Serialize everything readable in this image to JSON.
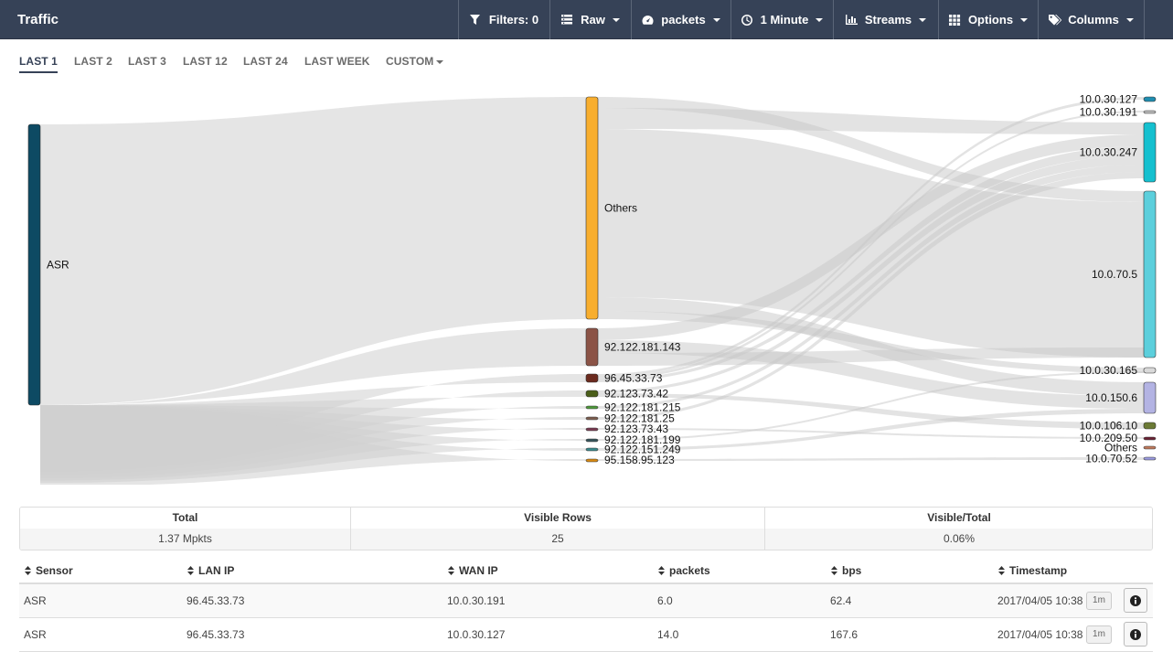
{
  "app": {
    "title": "Traffic"
  },
  "toolbar": [
    {
      "id": "filters",
      "label": "Filters: 0",
      "icon": "filter-icon",
      "caret": false
    },
    {
      "id": "raw",
      "label": "Raw",
      "icon": "list-icon",
      "caret": true
    },
    {
      "id": "packets",
      "label": "packets",
      "icon": "dashboard-icon",
      "caret": true
    },
    {
      "id": "interval",
      "label": "1 Minute",
      "icon": "clock-icon",
      "caret": true
    },
    {
      "id": "streams",
      "label": "Streams",
      "icon": "bar-chart-icon",
      "caret": true
    },
    {
      "id": "options",
      "label": "Options",
      "icon": "grid-icon",
      "caret": true
    },
    {
      "id": "columns",
      "label": "Columns",
      "icon": "tags-icon",
      "caret": true
    }
  ],
  "time_tabs": [
    {
      "label": "LAST 1",
      "active": true
    },
    {
      "label": "LAST 2",
      "active": false
    },
    {
      "label": "LAST 3",
      "active": false
    },
    {
      "label": "LAST 12",
      "active": false
    },
    {
      "label": "LAST 24",
      "active": false
    },
    {
      "label": "LAST WEEK",
      "active": false
    },
    {
      "label": "CUSTOM",
      "active": false,
      "caret": true
    }
  ],
  "sankey": {
    "sources": [
      {
        "label": "ASR",
        "color": "#0d4a63"
      }
    ],
    "middle": [
      {
        "label": "Others",
        "color": "#f8ae2e"
      },
      {
        "label": "92.122.181.143",
        "color": "#8b5346"
      },
      {
        "label": "96.45.33.73",
        "color": "#6b2a1e"
      },
      {
        "label": "92.123.73.42",
        "color": "#4a5e19"
      },
      {
        "label": "92.122.181.215",
        "color": "#4e9a3a"
      },
      {
        "label": "92.122.181.25",
        "color": "#7d5e4f"
      },
      {
        "label": "92.123.73.43",
        "color": "#7a3b52"
      },
      {
        "label": "92.122.181.199",
        "color": "#37545a"
      },
      {
        "label": "92.122.151.249",
        "color": "#3a8a8d"
      },
      {
        "label": "95.158.95.123",
        "color": "#d98a12"
      }
    ],
    "targets": [
      {
        "label": "10.0.30.127",
        "color": "#1f8db0"
      },
      {
        "label": "10.0.30.191",
        "color": "#bcbcbc"
      },
      {
        "label": "10.0.30.247",
        "color": "#15c0cf"
      },
      {
        "label": "10.0.70.5",
        "color": "#5ccfdc"
      },
      {
        "label": "10.0.30.165",
        "color": "#d9d9d9"
      },
      {
        "label": "10.0.150.6",
        "color": "#b3b3e3"
      },
      {
        "label": "10.0.106.10",
        "color": "#6b7a35"
      },
      {
        "label": "10.0.209.50",
        "color": "#6b2234"
      },
      {
        "label": "Others",
        "color": "#c17a5c"
      },
      {
        "label": "10.0.70.52",
        "color": "#9b9be0"
      }
    ]
  },
  "summary": [
    {
      "header": "Total",
      "value": "1.37 Mpkts"
    },
    {
      "header": "Visible Rows",
      "value": "25"
    },
    {
      "header": "Visible/Total",
      "value": "0.06%"
    }
  ],
  "table": {
    "columns": [
      "Sensor",
      "LAN IP",
      "WAN IP",
      "packets",
      "bps",
      "Timestamp"
    ],
    "rows": [
      {
        "sensor": "ASR",
        "lan_ip": "96.45.33.73",
        "wan_ip": "10.0.30.191",
        "packets": "6.0",
        "bps": "62.4",
        "timestamp": "2017/04/05 10:38",
        "interval": "1m"
      },
      {
        "sensor": "ASR",
        "lan_ip": "96.45.33.73",
        "wan_ip": "10.0.30.127",
        "packets": "14.0",
        "bps": "167.6",
        "timestamp": "2017/04/05 10:38",
        "interval": "1m"
      }
    ]
  }
}
